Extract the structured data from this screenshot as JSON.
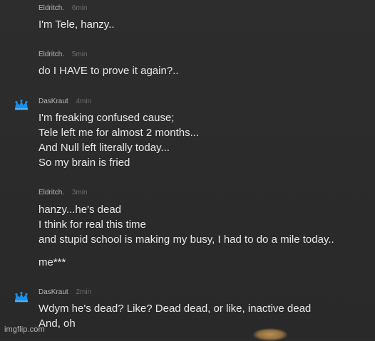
{
  "messages": [
    {
      "username": "Eldritch.",
      "time": "6min",
      "lines": [
        "I'm Tele, hanzy.."
      ]
    },
    {
      "username": "Eldritch.",
      "time": "5min",
      "lines": [
        "do I HAVE to prove it again?.."
      ]
    },
    {
      "username": "DasKraut",
      "time": "4min",
      "lines": [
        "I'm freaking confused cause;",
        "Tele left me for almost 2 months...",
        "And Null left literally today...",
        "So my brain is fried"
      ]
    },
    {
      "username": "Eldritch.",
      "time": "3min",
      "lines": [
        "hanzy...he's dead",
        "I think for real this time",
        "and stupid school is making my busy, I had to do a mile today..",
        "me***"
      ]
    },
    {
      "username": "DasKraut",
      "time": "2min",
      "lines": [
        "Wdym he's dead? Like? Dead dead, or like, inactive dead",
        "And, oh"
      ]
    }
  ],
  "watermark": "imgflip.com",
  "colors": {
    "background": "#2b2b2b",
    "username": "#b8b8b8",
    "timestamp": "#6f6f6f",
    "message": "#e8e8e8",
    "crown": "#1e8fe6"
  },
  "icons": {
    "crown": "crown-icon"
  }
}
